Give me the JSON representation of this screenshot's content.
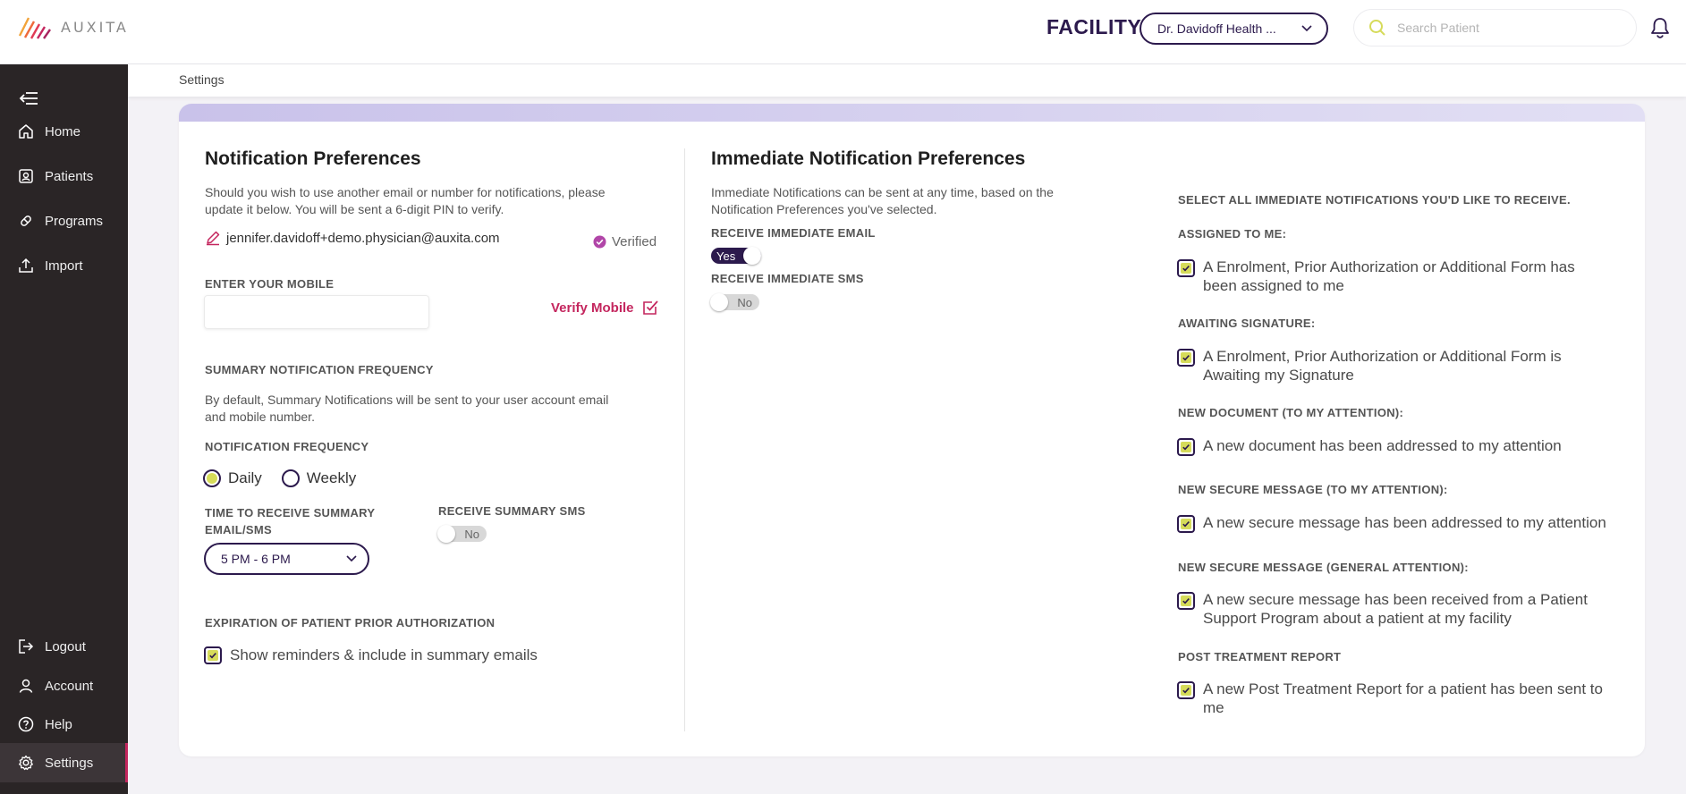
{
  "app": {
    "logo_text": "AUXITA"
  },
  "header": {
    "facility_label": "FACILITY",
    "facility_value": "Dr. Davidoff Health ...",
    "search_placeholder": "Search Patient"
  },
  "sidebar": {
    "items": [
      {
        "label": "Home",
        "icon": "home-icon"
      },
      {
        "label": "Patients",
        "icon": "patients-icon"
      },
      {
        "label": "Programs",
        "icon": "programs-icon"
      },
      {
        "label": "Import",
        "icon": "import-icon"
      }
    ],
    "bottom_items": [
      {
        "label": "Logout",
        "icon": "logout-icon"
      },
      {
        "label": "Account",
        "icon": "account-icon"
      },
      {
        "label": "Help",
        "icon": "help-icon"
      },
      {
        "label": "Settings",
        "icon": "settings-icon",
        "active": true
      }
    ]
  },
  "breadcrumb": "Settings",
  "notification_prefs": {
    "title": "Notification Preferences",
    "desc_line1": "Should you wish to use another email or number for notifications, please",
    "desc_line2": "update it below. You will be sent a 6-digit PIN to verify.",
    "email": "jennifer.davidoff+demo.physician@auxita.com",
    "verified_label": "Verified",
    "mobile_label": "ENTER YOUR MOBILE",
    "mobile_value": "",
    "verify_mobile_label": "Verify Mobile",
    "summary_freq_label": "SUMMARY NOTIFICATION FREQUENCY",
    "summary_desc_line1": "By default, Summary Notifications will be sent to your user account email",
    "summary_desc_line2": "and mobile number.",
    "notif_freq_label": "NOTIFICATION FREQUENCY",
    "freq_options": [
      "Daily",
      "Weekly"
    ],
    "freq_selected": "Daily",
    "time_label_line1": "TIME TO RECEIVE SUMMARY",
    "time_label_line2": "EMAIL/SMS",
    "time_value": "5 PM - 6 PM",
    "summary_sms_label": "RECEIVE SUMMARY SMS",
    "summary_sms_toggle": "No",
    "expiration_label": "EXPIRATION OF PATIENT PRIOR AUTHORIZATION",
    "expiration_checkbox": "Show reminders & include in summary emails"
  },
  "immediate_prefs": {
    "title": "Immediate Notification Preferences",
    "desc_line1": "Immediate Notifications can be sent at any time, based on the",
    "desc_line2": "Notification Preferences you've selected.",
    "email_label": "RECEIVE IMMEDIATE EMAIL",
    "email_toggle": "Yes",
    "sms_label": "RECEIVE IMMEDIATE SMS",
    "sms_toggle": "No",
    "select_all_label": "SELECT ALL IMMEDIATE NOTIFICATIONS YOU'D LIKE TO RECEIVE.",
    "groups": [
      {
        "heading": "ASSIGNED TO ME:",
        "line1": "A Enrolment, Prior Authorization or Additional Form has",
        "line2": "been assigned to me"
      },
      {
        "heading": "AWAITING SIGNATURE:",
        "line1": "A Enrolment, Prior Authorization or Additional Form is",
        "line2": "Awaiting my Signature"
      },
      {
        "heading": "NEW DOCUMENT (TO MY ATTENTION):",
        "line1": "A new document has been addressed to my attention",
        "line2": ""
      },
      {
        "heading": "NEW SECURE MESSAGE (TO MY ATTENTION):",
        "line1": "A new secure message has been addressed to my attention",
        "line2": ""
      },
      {
        "heading": "NEW SECURE MESSAGE (GENERAL ATTENTION):",
        "line1": "A new secure message has been received from a Patient",
        "line2": "Support Program about a patient at my facility"
      },
      {
        "heading": "POST TREATMENT REPORT",
        "line1": "A new Post Treatment Report for a patient has been sent to",
        "line2": "me"
      }
    ]
  },
  "colors": {
    "brand_dark": "#2c1a4d",
    "accent_pink": "#c4265e",
    "check_yellow": "#d6db5a",
    "sidebar_bg": "#2a2526"
  }
}
